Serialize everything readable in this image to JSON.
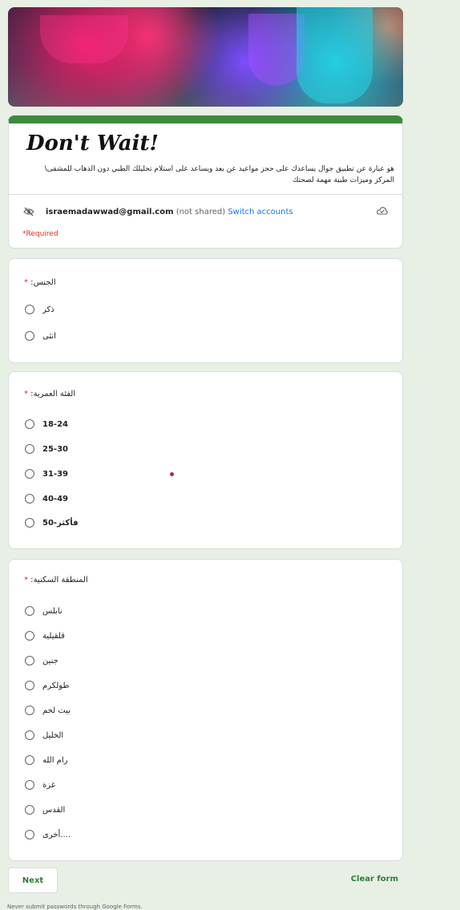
{
  "header": {
    "title": "Don't Wait!",
    "description": "هو عبارة عن تطبيق جوال يساعدك على حجز مواعيد عن بعد ويساعد على استلام تحليلك الطبي دون الذهاب للمشفى\\ المركز وميزات طبية مهمة لصحتك",
    "account_email": "israemadawwad@gmail.com",
    "not_shared": "(not shared)",
    "switch_accounts": "Switch accounts",
    "required_note": "*Required"
  },
  "icons": {
    "no_eye": "eye-slash-icon",
    "cloud": "cloud-check-icon"
  },
  "questions": [
    {
      "title": "الجنس",
      "required_mark": "*",
      "options": [
        "ذكر",
        "انثى"
      ]
    },
    {
      "title": "الفئة العمرية",
      "required_mark": "*",
      "options": [
        "18-24",
        "25-30",
        "31-39",
        "40-49",
        "50-فأكثر"
      ]
    },
    {
      "title": "المنطقة السكنية",
      "required_mark": "*",
      "options": [
        "نابلس",
        "قلقيلية",
        "جنين",
        "طولكرم",
        "بيت لحم",
        "الخليل",
        "رام الله",
        "غزة",
        "القدس",
        "أخرى...."
      ]
    }
  ],
  "footer": {
    "next_label": "Next",
    "clear_label": "Clear form",
    "notice": "Never submit passwords through Google Forms."
  },
  "colors": {
    "accent": "#3c8a3f",
    "link": "#1a73e8",
    "required": "#d93025",
    "background": "#e8efe4"
  }
}
